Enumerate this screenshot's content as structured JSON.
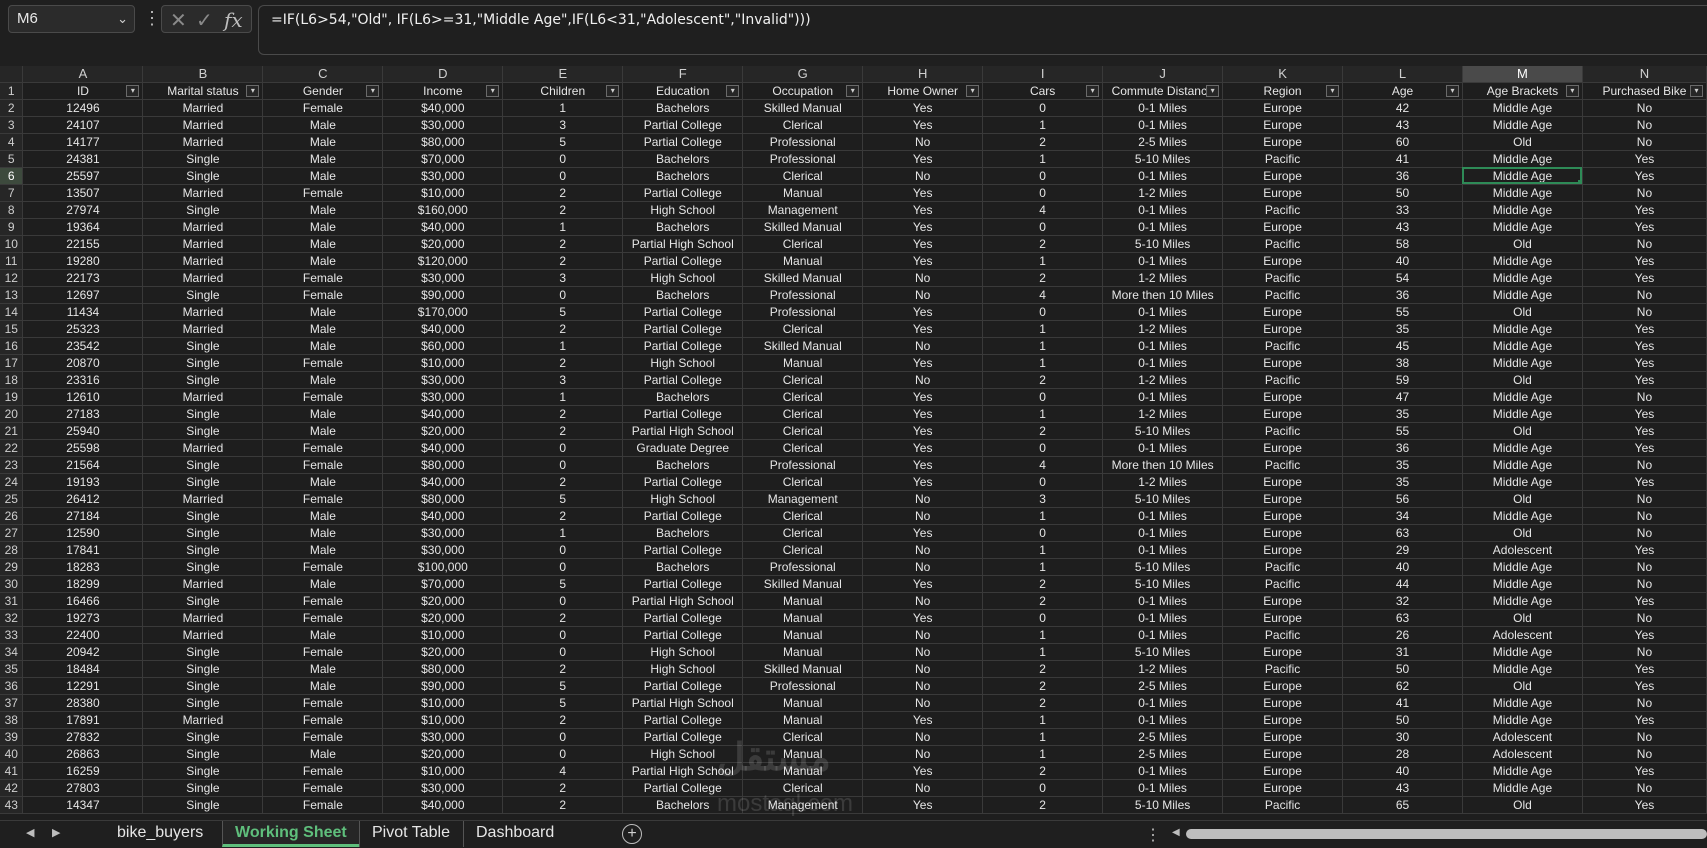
{
  "formula_bar": {
    "name_box": "M6",
    "formula": "=IF(L6>54,\"Old\", IF(L6>=31,\"Middle Age\",IF(L6<31,\"Adolescent\",\"Invalid\")))"
  },
  "columns": [
    "A",
    "B",
    "C",
    "D",
    "E",
    "F",
    "G",
    "H",
    "I",
    "J",
    "K",
    "L",
    "M",
    "N"
  ],
  "selected_column": "M",
  "headers": [
    "ID",
    "Marital status",
    "Gender",
    "Income",
    "Children",
    "Education",
    "Occupation",
    "Home Owner",
    "Cars",
    "Commute Distance",
    "Region",
    "Age",
    "Age Brackets",
    "Purchased Bike"
  ],
  "rows": [
    [
      "12496",
      "Married",
      "Female",
      "$40,000",
      "1",
      "Bachelors",
      "Skilled Manual",
      "Yes",
      "0",
      "0-1 Miles",
      "Europe",
      "42",
      "Middle Age",
      "No"
    ],
    [
      "24107",
      "Married",
      "Male",
      "$30,000",
      "3",
      "Partial College",
      "Clerical",
      "Yes",
      "1",
      "0-1 Miles",
      "Europe",
      "43",
      "Middle Age",
      "No"
    ],
    [
      "14177",
      "Married",
      "Male",
      "$80,000",
      "5",
      "Partial College",
      "Professional",
      "No",
      "2",
      "2-5 Miles",
      "Europe",
      "60",
      "Old",
      "No"
    ],
    [
      "24381",
      "Single",
      "Male",
      "$70,000",
      "0",
      "Bachelors",
      "Professional",
      "Yes",
      "1",
      "5-10 Miles",
      "Pacific",
      "41",
      "Middle Age",
      "Yes"
    ],
    [
      "25597",
      "Single",
      "Male",
      "$30,000",
      "0",
      "Bachelors",
      "Clerical",
      "No",
      "0",
      "0-1 Miles",
      "Europe",
      "36",
      "Middle Age",
      "Yes"
    ],
    [
      "13507",
      "Married",
      "Female",
      "$10,000",
      "2",
      "Partial College",
      "Manual",
      "Yes",
      "0",
      "1-2 Miles",
      "Europe",
      "50",
      "Middle Age",
      "No"
    ],
    [
      "27974",
      "Single",
      "Male",
      "$160,000",
      "2",
      "High School",
      "Management",
      "Yes",
      "4",
      "0-1 Miles",
      "Pacific",
      "33",
      "Middle Age",
      "Yes"
    ],
    [
      "19364",
      "Married",
      "Male",
      "$40,000",
      "1",
      "Bachelors",
      "Skilled Manual",
      "Yes",
      "0",
      "0-1 Miles",
      "Europe",
      "43",
      "Middle Age",
      "Yes"
    ],
    [
      "22155",
      "Married",
      "Male",
      "$20,000",
      "2",
      "Partial High School",
      "Clerical",
      "Yes",
      "2",
      "5-10 Miles",
      "Pacific",
      "58",
      "Old",
      "No"
    ],
    [
      "19280",
      "Married",
      "Male",
      "$120,000",
      "2",
      "Partial College",
      "Manual",
      "Yes",
      "1",
      "0-1 Miles",
      "Europe",
      "40",
      "Middle Age",
      "Yes"
    ],
    [
      "22173",
      "Married",
      "Female",
      "$30,000",
      "3",
      "High School",
      "Skilled Manual",
      "No",
      "2",
      "1-2 Miles",
      "Pacific",
      "54",
      "Middle Age",
      "Yes"
    ],
    [
      "12697",
      "Single",
      "Female",
      "$90,000",
      "0",
      "Bachelors",
      "Professional",
      "No",
      "4",
      "More then 10 Miles",
      "Pacific",
      "36",
      "Middle Age",
      "No"
    ],
    [
      "11434",
      "Married",
      "Male",
      "$170,000",
      "5",
      "Partial College",
      "Professional",
      "Yes",
      "0",
      "0-1 Miles",
      "Europe",
      "55",
      "Old",
      "No"
    ],
    [
      "25323",
      "Married",
      "Male",
      "$40,000",
      "2",
      "Partial College",
      "Clerical",
      "Yes",
      "1",
      "1-2 Miles",
      "Europe",
      "35",
      "Middle Age",
      "Yes"
    ],
    [
      "23542",
      "Single",
      "Male",
      "$60,000",
      "1",
      "Partial College",
      "Skilled Manual",
      "No",
      "1",
      "0-1 Miles",
      "Pacific",
      "45",
      "Middle Age",
      "Yes"
    ],
    [
      "20870",
      "Single",
      "Female",
      "$10,000",
      "2",
      "High School",
      "Manual",
      "Yes",
      "1",
      "0-1 Miles",
      "Europe",
      "38",
      "Middle Age",
      "Yes"
    ],
    [
      "23316",
      "Single",
      "Male",
      "$30,000",
      "3",
      "Partial College",
      "Clerical",
      "No",
      "2",
      "1-2 Miles",
      "Pacific",
      "59",
      "Old",
      "Yes"
    ],
    [
      "12610",
      "Married",
      "Female",
      "$30,000",
      "1",
      "Bachelors",
      "Clerical",
      "Yes",
      "0",
      "0-1 Miles",
      "Europe",
      "47",
      "Middle Age",
      "No"
    ],
    [
      "27183",
      "Single",
      "Male",
      "$40,000",
      "2",
      "Partial College",
      "Clerical",
      "Yes",
      "1",
      "1-2 Miles",
      "Europe",
      "35",
      "Middle Age",
      "Yes"
    ],
    [
      "25940",
      "Single",
      "Male",
      "$20,000",
      "2",
      "Partial High School",
      "Clerical",
      "Yes",
      "2",
      "5-10 Miles",
      "Pacific",
      "55",
      "Old",
      "Yes"
    ],
    [
      "25598",
      "Married",
      "Female",
      "$40,000",
      "0",
      "Graduate Degree",
      "Clerical",
      "Yes",
      "0",
      "0-1 Miles",
      "Europe",
      "36",
      "Middle Age",
      "Yes"
    ],
    [
      "21564",
      "Single",
      "Female",
      "$80,000",
      "0",
      "Bachelors",
      "Professional",
      "Yes",
      "4",
      "More then 10 Miles",
      "Pacific",
      "35",
      "Middle Age",
      "No"
    ],
    [
      "19193",
      "Single",
      "Male",
      "$40,000",
      "2",
      "Partial College",
      "Clerical",
      "Yes",
      "0",
      "1-2 Miles",
      "Europe",
      "35",
      "Middle Age",
      "Yes"
    ],
    [
      "26412",
      "Married",
      "Female",
      "$80,000",
      "5",
      "High School",
      "Management",
      "No",
      "3",
      "5-10 Miles",
      "Europe",
      "56",
      "Old",
      "No"
    ],
    [
      "27184",
      "Single",
      "Male",
      "$40,000",
      "2",
      "Partial College",
      "Clerical",
      "No",
      "1",
      "0-1 Miles",
      "Europe",
      "34",
      "Middle Age",
      "No"
    ],
    [
      "12590",
      "Single",
      "Male",
      "$30,000",
      "1",
      "Bachelors",
      "Clerical",
      "Yes",
      "0",
      "0-1 Miles",
      "Europe",
      "63",
      "Old",
      "No"
    ],
    [
      "17841",
      "Single",
      "Male",
      "$30,000",
      "0",
      "Partial College",
      "Clerical",
      "No",
      "1",
      "0-1 Miles",
      "Europe",
      "29",
      "Adolescent",
      "Yes"
    ],
    [
      "18283",
      "Single",
      "Female",
      "$100,000",
      "0",
      "Bachelors",
      "Professional",
      "No",
      "1",
      "5-10 Miles",
      "Pacific",
      "40",
      "Middle Age",
      "No"
    ],
    [
      "18299",
      "Married",
      "Male",
      "$70,000",
      "5",
      "Partial College",
      "Skilled Manual",
      "Yes",
      "2",
      "5-10 Miles",
      "Pacific",
      "44",
      "Middle Age",
      "No"
    ],
    [
      "16466",
      "Single",
      "Female",
      "$20,000",
      "0",
      "Partial High School",
      "Manual",
      "No",
      "2",
      "0-1 Miles",
      "Europe",
      "32",
      "Middle Age",
      "Yes"
    ],
    [
      "19273",
      "Married",
      "Female",
      "$20,000",
      "2",
      "Partial College",
      "Manual",
      "Yes",
      "0",
      "0-1 Miles",
      "Europe",
      "63",
      "Old",
      "No"
    ],
    [
      "22400",
      "Married",
      "Male",
      "$10,000",
      "0",
      "Partial College",
      "Manual",
      "No",
      "1",
      "0-1 Miles",
      "Pacific",
      "26",
      "Adolescent",
      "Yes"
    ],
    [
      "20942",
      "Single",
      "Female",
      "$20,000",
      "0",
      "High School",
      "Manual",
      "No",
      "1",
      "5-10 Miles",
      "Europe",
      "31",
      "Middle Age",
      "No"
    ],
    [
      "18484",
      "Single",
      "Male",
      "$80,000",
      "2",
      "High School",
      "Skilled Manual",
      "No",
      "2",
      "1-2 Miles",
      "Pacific",
      "50",
      "Middle Age",
      "Yes"
    ],
    [
      "12291",
      "Single",
      "Male",
      "$90,000",
      "5",
      "Partial College",
      "Professional",
      "No",
      "2",
      "2-5 Miles",
      "Europe",
      "62",
      "Old",
      "Yes"
    ],
    [
      "28380",
      "Single",
      "Female",
      "$10,000",
      "5",
      "Partial High School",
      "Manual",
      "No",
      "2",
      "0-1 Miles",
      "Europe",
      "41",
      "Middle Age",
      "No"
    ],
    [
      "17891",
      "Married",
      "Female",
      "$10,000",
      "2",
      "Partial College",
      "Manual",
      "Yes",
      "1",
      "0-1 Miles",
      "Europe",
      "50",
      "Middle Age",
      "Yes"
    ],
    [
      "27832",
      "Single",
      "Female",
      "$30,000",
      "0",
      "Partial College",
      "Clerical",
      "No",
      "1",
      "2-5 Miles",
      "Europe",
      "30",
      "Adolescent",
      "No"
    ],
    [
      "26863",
      "Single",
      "Male",
      "$20,000",
      "0",
      "High School",
      "Manual",
      "No",
      "1",
      "2-5 Miles",
      "Europe",
      "28",
      "Adolescent",
      "No"
    ],
    [
      "16259",
      "Single",
      "Female",
      "$10,000",
      "4",
      "Partial High School",
      "Manual",
      "Yes",
      "2",
      "0-1 Miles",
      "Europe",
      "40",
      "Middle Age",
      "Yes"
    ],
    [
      "27803",
      "Single",
      "Female",
      "$30,000",
      "2",
      "Partial College",
      "Clerical",
      "No",
      "0",
      "0-1 Miles",
      "Europe",
      "43",
      "Middle Age",
      "No"
    ],
    [
      "14347",
      "Single",
      "Female",
      "$40,000",
      "2",
      "Bachelors",
      "Management",
      "Yes",
      "2",
      "5-10 Miles",
      "Pacific",
      "65",
      "Old",
      "Yes"
    ]
  ],
  "active_cell": {
    "row": 6,
    "col": 13
  },
  "watermark": {
    "line1": "مستقل",
    "line2": "mostaql.com"
  },
  "sheet_tabs": [
    "bike_buyers",
    "Working Sheet",
    "Pivot Table",
    "Dashboard"
  ],
  "active_tab": "Working Sheet",
  "colors": {
    "accent": "#5fbf7c",
    "grid_bg": "#1e1e1e",
    "selection": "#2e8b57"
  },
  "icons": {
    "name_box_chevron": "chevron-down-icon",
    "cancel": "x-icon",
    "enter": "check-icon",
    "function": "fx-icon",
    "add_sheet": "plus-icon"
  }
}
